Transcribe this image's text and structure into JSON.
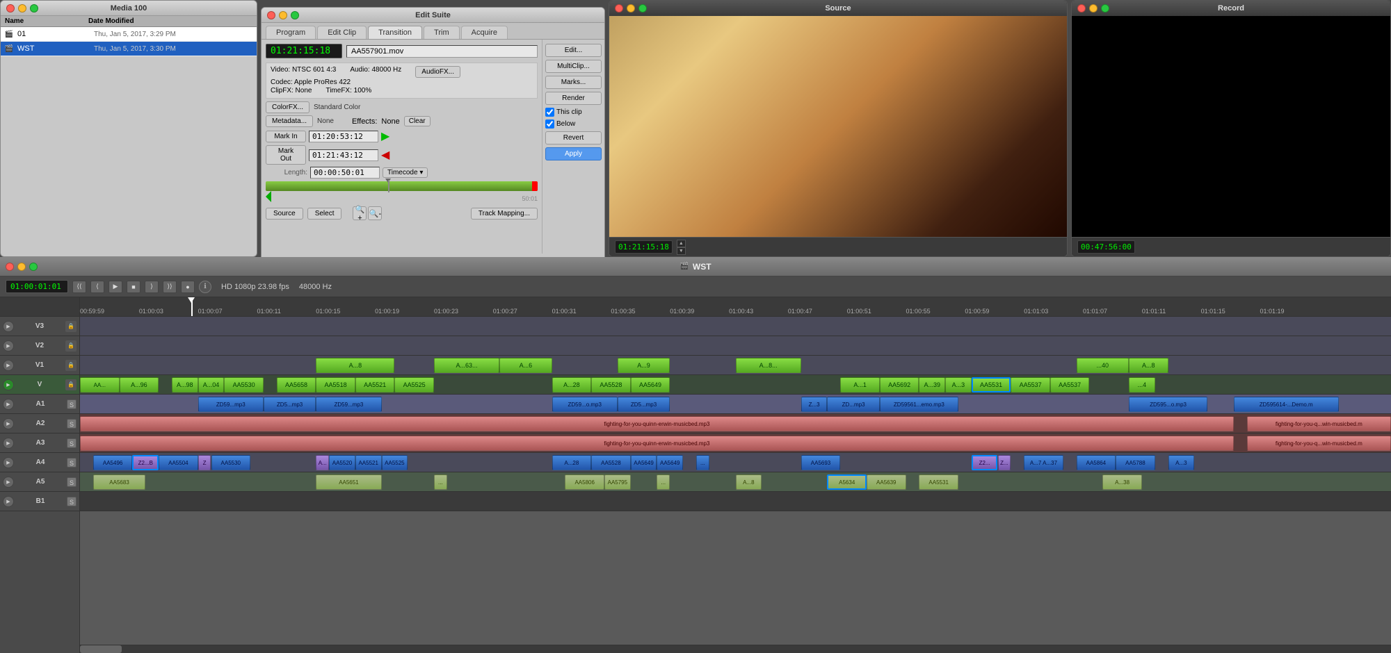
{
  "mediaPanel": {
    "title": "Media 100",
    "columns": [
      "Name",
      "Date Modified"
    ],
    "items": [
      {
        "icon": "🎬",
        "name": "01",
        "date": "Thu, Jan 5, 2017, 3:29 PM",
        "selected": false
      },
      {
        "icon": "🎬",
        "name": "WST",
        "date": "Thu, Jan 5, 2017, 3:30 PM",
        "selected": true
      }
    ]
  },
  "editSuite": {
    "title": "Edit Suite",
    "tabs": [
      "Program",
      "Edit Clip",
      "Transition",
      "Trim",
      "Acquire"
    ],
    "activeTab": "Transition",
    "timecode": "01:21:15:18",
    "filename": "AA557901.mov",
    "video": "Video: NTSC 601 4:3",
    "codec": "Codec: Apple ProRes 422",
    "clipfx": "ClipFX: None",
    "audio": "Audio: 48000 Hz",
    "timefx": "TimeFX: 100%",
    "colorfx": {
      "label": "ColorFX...",
      "value": "Standard Color"
    },
    "metadata": {
      "label": "Metadata...",
      "value": "None"
    },
    "effects": {
      "label": "Effects:",
      "value": "None"
    },
    "markIn": {
      "label": "Mark In",
      "value": "01:20:53:12"
    },
    "markOut": {
      "label": "Mark Out",
      "value": "01:21:43:12"
    },
    "length": {
      "label": "Length:",
      "value": "00:00:50:01",
      "mode": "Timecode"
    },
    "clipBarTime": "50:01",
    "sideButtons": [
      "Edit...",
      "MultiClip...",
      "Marks...",
      "Render",
      "Revert",
      "Apply"
    ],
    "checkboxes": [
      {
        "label": "This clip",
        "checked": true
      },
      {
        "label": "Below",
        "checked": true
      }
    ],
    "bottomButtons": [
      "Source",
      "Select"
    ],
    "trackMapBtn": "Track Mapping...",
    "clearBtn": "Clear"
  },
  "sourceMonitor": {
    "title": "Source",
    "timecode": "01:21:15:18",
    "recordTimecode": "00:47:56:00"
  },
  "recordMonitor": {
    "title": "Record"
  },
  "timeline": {
    "title": "WST",
    "timecode": "01:00:01:01",
    "format": "HD 1080p 23.98 fps",
    "sampleRate": "48000 Hz",
    "tracks": [
      {
        "name": "V3",
        "type": "v"
      },
      {
        "name": "V2",
        "type": "v"
      },
      {
        "name": "V1",
        "type": "v"
      },
      {
        "name": "V",
        "type": "v",
        "active": true
      },
      {
        "name": "A1",
        "type": "a"
      },
      {
        "name": "A2",
        "type": "a"
      },
      {
        "name": "A3",
        "type": "a"
      },
      {
        "name": "A4",
        "type": "a"
      },
      {
        "name": "A5",
        "type": "a"
      },
      {
        "name": "B1",
        "type": "b"
      }
    ],
    "rulerMarks": [
      "00:59:59",
      "01:00:03",
      "01:00:07",
      "01:00:11",
      "01:00:15",
      "01:00:19",
      "01:00:23",
      "01:00:27",
      "01:00:31",
      "01:00:35",
      "01:00:39",
      "01:00:43",
      "01:00:47",
      "01:00:51",
      "01:00:55",
      "01:00:59",
      "01:01:03",
      "01:01:07",
      "01:01:11",
      "01:01:15",
      "01:01:19"
    ]
  }
}
